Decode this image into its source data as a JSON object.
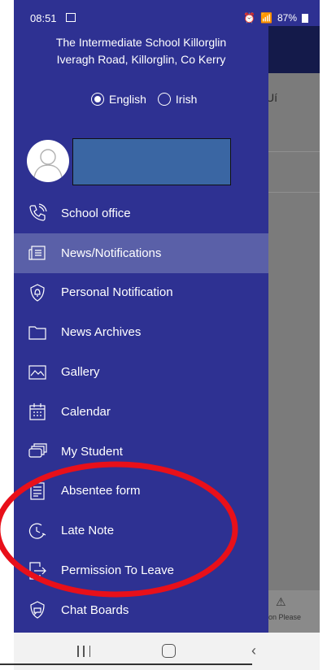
{
  "status_bar": {
    "time": "08:51",
    "battery": "87%"
  },
  "school": {
    "name": "The Intermediate School Killorglin",
    "address": "Iveragh Road, Killorglin, Co Kerry"
  },
  "language": {
    "options": [
      "English",
      "Irish"
    ],
    "selected": "English"
  },
  "background_app": {
    "header_char": "Uí",
    "alert_text": "on Please"
  },
  "menu": [
    {
      "label": "School office",
      "icon": "phone-icon"
    },
    {
      "label": "News/Notifications",
      "icon": "news-icon",
      "active": true
    },
    {
      "label": "Personal Notification",
      "icon": "shield-bell-icon"
    },
    {
      "label": "News Archives",
      "icon": "folder-icon"
    },
    {
      "label": "Gallery",
      "icon": "gallery-icon"
    },
    {
      "label": "Calendar",
      "icon": "calendar-icon"
    },
    {
      "label": "My Student",
      "icon": "cards-icon"
    },
    {
      "label": "Absentee form",
      "icon": "form-icon"
    },
    {
      "label": "Late Note",
      "icon": "clock-icon"
    },
    {
      "label": "Permission To Leave",
      "icon": "exit-icon"
    },
    {
      "label": "Chat Boards",
      "icon": "chat-shield-icon"
    }
  ],
  "colors": {
    "drawer": "#2e3192",
    "active_item": "#5a60a8",
    "highlight_oval": "#e8101a",
    "name_box": "#3a66a3"
  }
}
